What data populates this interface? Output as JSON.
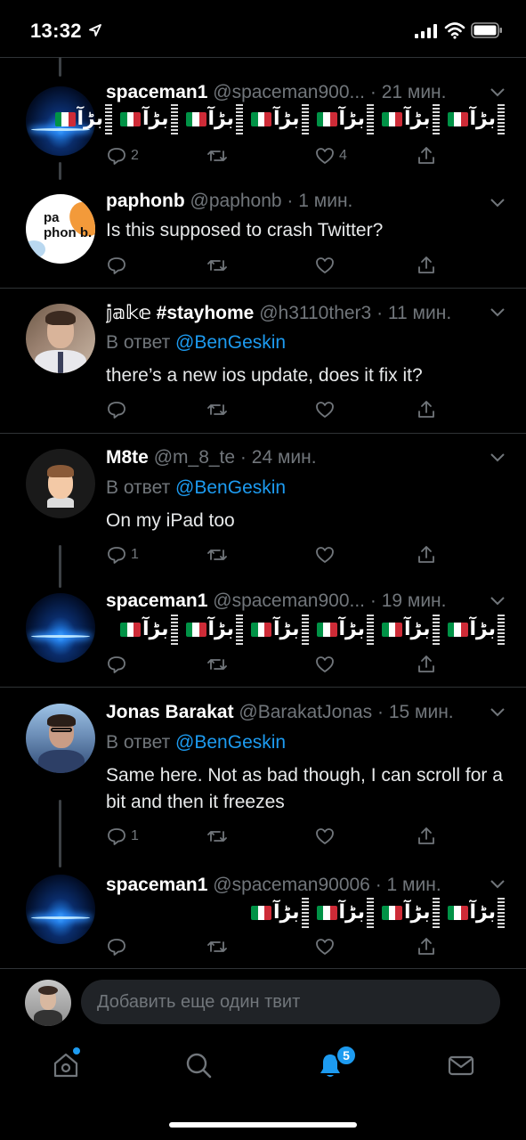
{
  "status": {
    "time": "13:32"
  },
  "tweets": [
    {
      "name": "spaceman1",
      "handle": "@spaceman900...",
      "dot": "·",
      "time": "21 мин.",
      "flags_count": 7,
      "reply_count": "2",
      "like_count": "4"
    },
    {
      "name": "paphonb",
      "handle": "@paphonb",
      "dot": "·",
      "time": "1 мин.",
      "text": "Is this supposed to crash Twitter?",
      "avatar_text": "pa phon b.",
      "reply_count": "",
      "like_count": ""
    },
    {
      "name": "𝕛𝕒𝕜𝕖 #stayhome",
      "handle": "@h3110ther3",
      "dot": "·",
      "time": "11 мин.",
      "reply_prefix": "В ответ",
      "reply_user": "@BenGeskin",
      "text": "there’s a new ios update, does it fix it?",
      "reply_count": "",
      "like_count": ""
    },
    {
      "name": "M8te",
      "handle": "@m_8_te",
      "dot": "·",
      "time": "24 мин.",
      "reply_prefix": "В ответ",
      "reply_user": "@BenGeskin",
      "text": "On my iPad too",
      "reply_count": "1",
      "like_count": ""
    },
    {
      "name": "spaceman1",
      "handle": "@spaceman900...",
      "dot": "·",
      "time": "19 мин.",
      "flags_count": 6,
      "reply_count": "",
      "like_count": ""
    },
    {
      "name": "Jonas Barakat",
      "handle": "@BarakatJonas",
      "dot": "·",
      "time": "15 мин.",
      "reply_prefix": "В ответ",
      "reply_user": "@BenGeskin",
      "text": "Same here. Not as bad though, I can scroll for a bit and then it freezes",
      "reply_count": "1",
      "like_count": ""
    },
    {
      "name": "spaceman1",
      "handle": "@spaceman90006",
      "dot": "·",
      "time": "1 мин.",
      "flags_count": 4,
      "reply_count": "",
      "like_count": ""
    }
  ],
  "flag_glyph": "بڑآ",
  "composer": {
    "placeholder": "Добавить еще один твит"
  },
  "tabbar": {
    "notifications_badge": "5"
  },
  "colors": {
    "accent": "#1d9bf0",
    "background": "#000000",
    "secondary_text": "#71767b",
    "divider": "#2f3336"
  },
  "icons": [
    "location-arrow-icon",
    "signal-icon",
    "wifi-icon",
    "battery-icon",
    "chevron-down-icon",
    "reply-icon",
    "retweet-icon",
    "like-icon",
    "share-icon",
    "home-icon",
    "search-icon",
    "bell-icon",
    "mail-icon"
  ]
}
